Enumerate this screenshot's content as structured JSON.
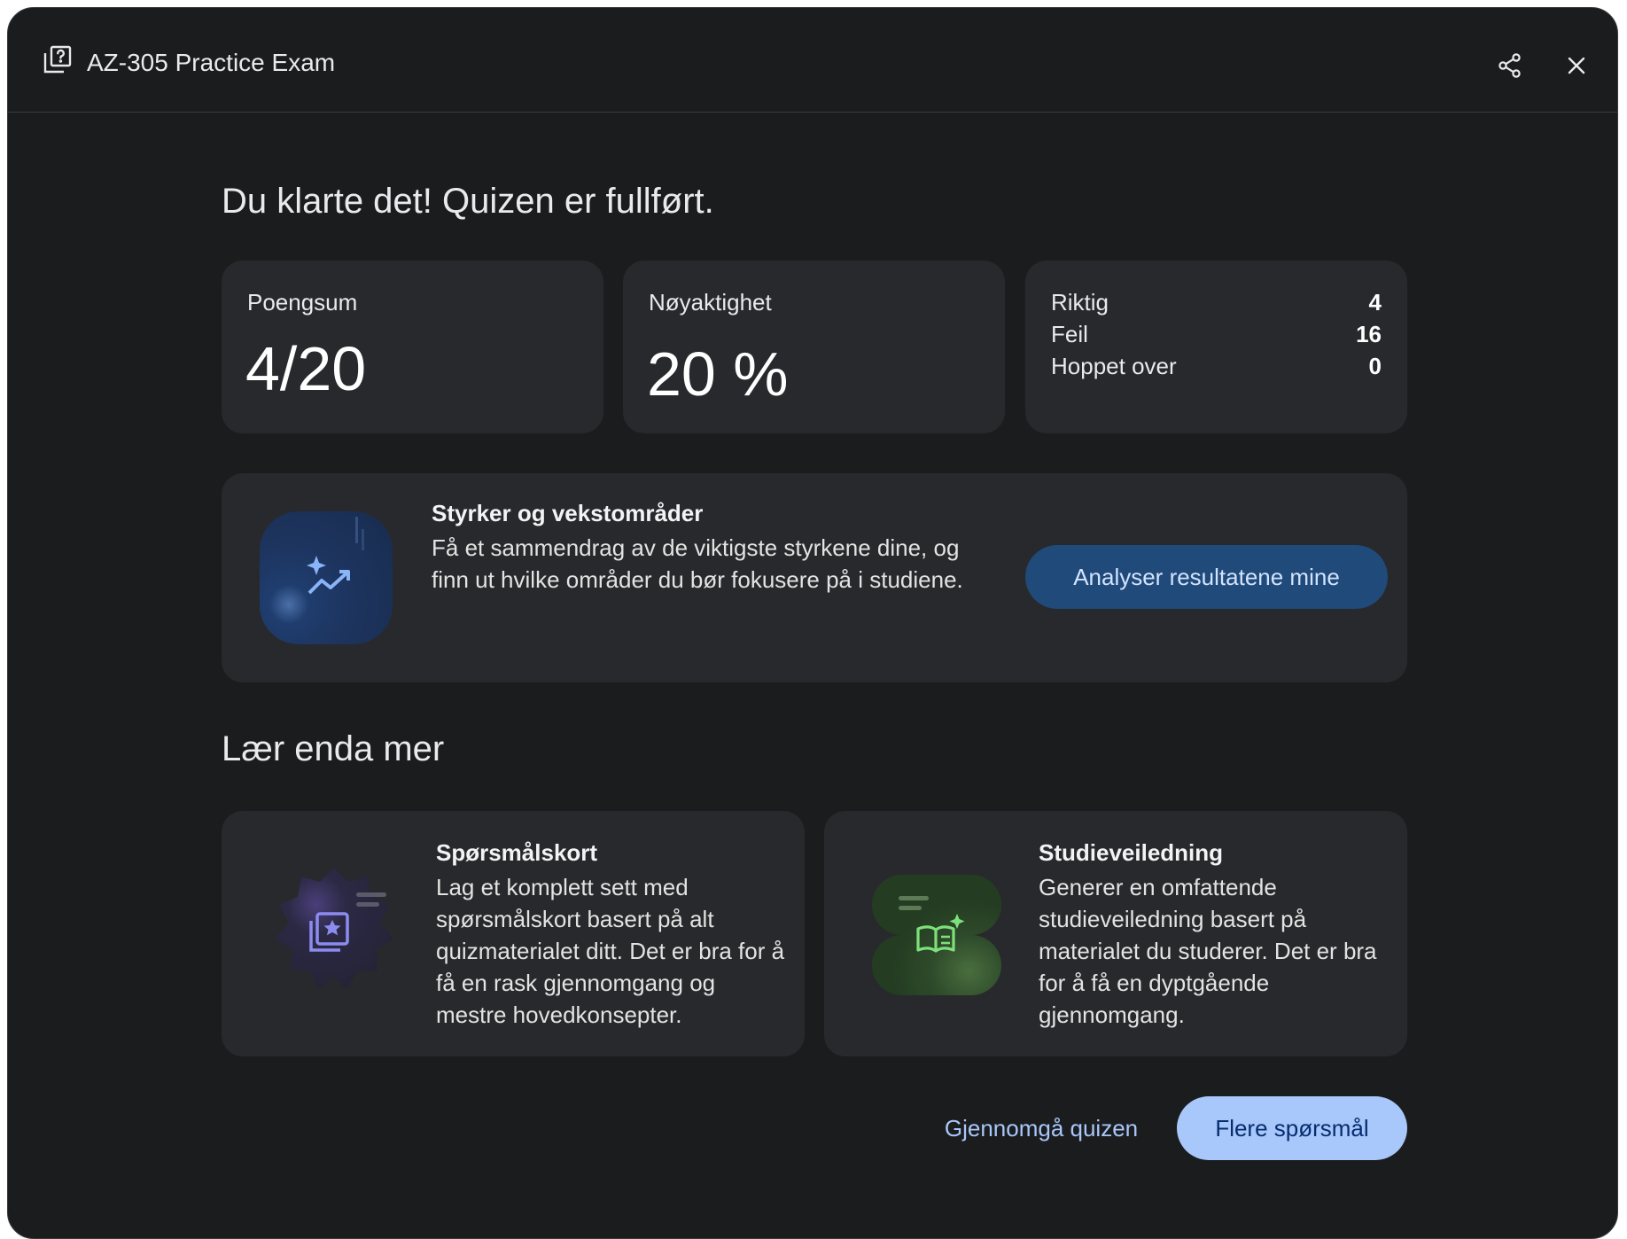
{
  "header": {
    "title": "AZ-305 Practice Exam",
    "title_icon": "quiz-icon",
    "share_icon": "share-icon",
    "close_icon": "close-icon"
  },
  "main": {
    "heading": "Du klarte det! Quizen er fullført.",
    "score": {
      "label": "Poengsum",
      "value": "4/20"
    },
    "accuracy": {
      "label": "Nøyaktighet",
      "value": "20 %"
    },
    "breakdown": [
      {
        "label": "Riktig",
        "value": "4"
      },
      {
        "label": "Feil",
        "value": "16"
      },
      {
        "label": "Hoppet over",
        "value": "0"
      }
    ],
    "strengths": {
      "title": "Styrker og vekstområder",
      "description": "Få et sammendrag av de viktigste styrkene dine, og finn ut hvilke områder du bør fokusere på i studiene.",
      "button_label": "Analyser resultatene mine",
      "icon": "trending-up-sparkle-icon"
    },
    "learn_more": {
      "heading": "Lær enda mer",
      "cards": [
        {
          "title": "Spørsmålskort",
          "description": "Lag et komplett sett med spørsmålskort basert på alt quizmaterialet ditt. Det er bra for å få en rask gjennomgang og mestre hovedkonsepter.",
          "icon": "flashcards-icon"
        },
        {
          "title": "Studieveiledning",
          "description": "Generer en omfattende studieveiledning basert på materialet du studerer. Det er bra for å få en dyptgående gjennomgang.",
          "icon": "study-guide-book-icon"
        }
      ]
    }
  },
  "footer": {
    "review_label": "Gjennomgå quizen",
    "more_label": "Flere spørsmål"
  },
  "colors": {
    "background": "#1b1c1e",
    "card": "#28292c",
    "primary_button": "#a8c7fa",
    "tonal_button": "#1f4a7a",
    "link": "#a8c7fa"
  }
}
